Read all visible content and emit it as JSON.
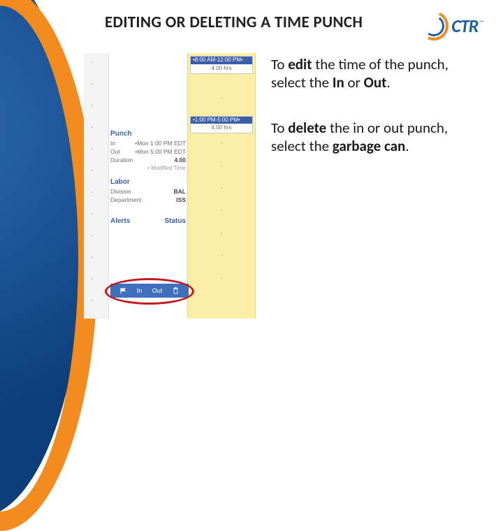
{
  "title": "EDITING OR DELETING A TIME PUNCH",
  "logo": {
    "text": "CTR",
    "tm": "™"
  },
  "instructions": {
    "edit_pre": "To ",
    "edit_b1": "edit",
    "edit_mid": " the time of the punch, select the ",
    "edit_b2": "In",
    "edit_or": " or ",
    "edit_b3": "Out",
    "edit_end": ".",
    "del_pre": "To ",
    "del_b1": "delete",
    "del_mid": " the in or out punch, select the ",
    "del_b2": "garbage can",
    "del_end": "."
  },
  "calendar": {
    "block1": {
      "hdr": "•8:00 AM-12:00 PM•",
      "hrs": "4.00 hrs"
    },
    "block2": {
      "hdr": "•1:00 PM-5:00 PM•",
      "hrs": "4.00 hrs"
    }
  },
  "details": {
    "punch_title": "Punch",
    "in_label": "In",
    "in_value": "•Mon 1:00 PM EDT",
    "out_label": "Out",
    "out_value": "•Mon 5:00 PM EDT",
    "duration_label": "Duration",
    "duration_value": "4.00",
    "modified": "• Modified Time",
    "labor_title": "Labor",
    "division_label": "Division",
    "division_value": "BAL",
    "department_label": "Department",
    "department_value": "ISS",
    "alerts_label": "Alerts",
    "status_label": "Status"
  },
  "action_bar": {
    "in": "In",
    "out": "Out"
  }
}
